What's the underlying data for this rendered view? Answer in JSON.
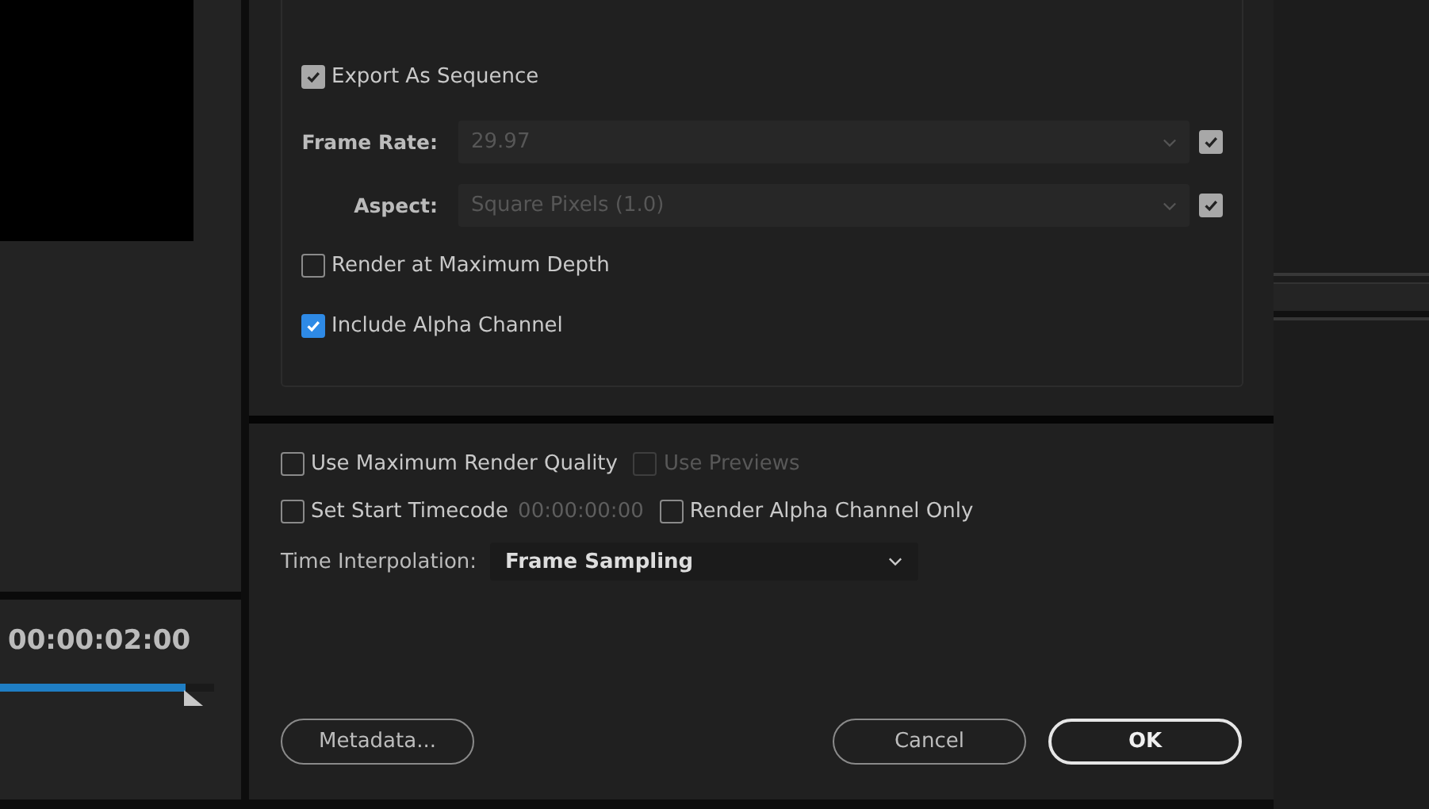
{
  "monitor": {
    "timecode": "00:00:02:00",
    "playback": {
      "level": 0.87
    }
  },
  "video": {
    "export_sequence": {
      "label": "Export As Sequence",
      "checked": true,
      "disabled": false,
      "focused": false
    },
    "fields": [
      {
        "label": "Frame Rate:",
        "value": "29.97",
        "disabled": true,
        "checked": true
      },
      {
        "label": "Aspect:",
        "value": "Square Pixels (1.0)",
        "disabled": true,
        "checked": true
      }
    ],
    "options": [
      {
        "label": "Render at Maximum Depth",
        "checked": false,
        "disabled": false
      },
      {
        "label": "Include Alpha Channel",
        "checked": true,
        "disabled": false,
        "focused": true
      }
    ]
  },
  "render": {
    "row1": [
      {
        "label": "Use Maximum Render Quality",
        "checked": false,
        "disabled": false
      },
      {
        "label": "Use Previews",
        "checked": false,
        "disabled": true
      }
    ],
    "start_timecode": {
      "label": "Set Start Timecode",
      "checked": false,
      "disabled": false,
      "value": "00:00:00:00"
    },
    "alpha_only": {
      "label": "Render Alpha Channel Only",
      "checked": false,
      "disabled": false
    },
    "interpolation": {
      "label": "Time Interpolation:",
      "value": "Frame Sampling"
    }
  },
  "buttons": [
    {
      "label": "Metadata...",
      "kind": "secondary"
    },
    {
      "label": "Cancel",
      "kind": "secondary"
    },
    {
      "label": "OK",
      "kind": "default"
    }
  ]
}
